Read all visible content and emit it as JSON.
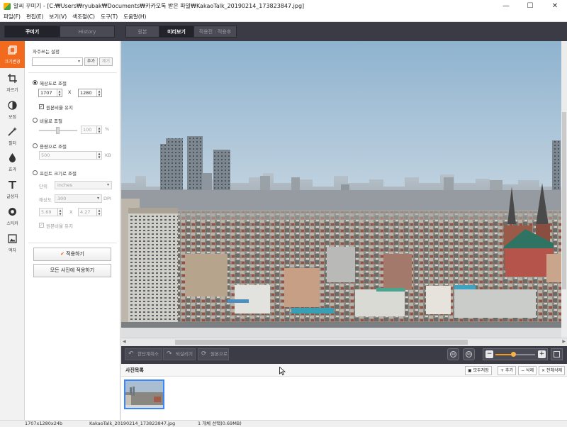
{
  "window": {
    "title": "알씨 꾸미기 - [C:₩Users₩ryubak₩Documents₩카카오톡 받은 파일₩KakaoTalk_20190214_173823847.jpg]",
    "minimize": "—",
    "maximize": "☐",
    "close": "✕"
  },
  "menu": [
    "파일(F)",
    "편집(E)",
    "보기(V)",
    "색조절(C)",
    "도구(T)",
    "도움말(H)"
  ],
  "top_tabs": {
    "left": [
      {
        "label": "꾸미기",
        "active": true
      },
      {
        "label": "History",
        "active": false
      }
    ],
    "right": [
      {
        "label": "원본",
        "active": false
      },
      {
        "label": "미리보기",
        "active": true
      },
      {
        "label": "적용전 : 적용후",
        "active": false
      }
    ]
  },
  "tools": [
    {
      "label": "크기변경",
      "icon": "resize-icon",
      "active": true
    },
    {
      "label": "자르기",
      "icon": "crop-icon",
      "active": false
    },
    {
      "label": "보정",
      "icon": "contrast-icon",
      "active": false
    },
    {
      "label": "필터",
      "icon": "magic-wand-icon",
      "active": false
    },
    {
      "label": "효과",
      "icon": "drop-icon",
      "active": false
    },
    {
      "label": "글상자",
      "icon": "text-icon",
      "active": false
    },
    {
      "label": "스티커",
      "icon": "sticker-icon",
      "active": false
    },
    {
      "label": "액자",
      "icon": "frame-icon",
      "active": false
    }
  ],
  "panel": {
    "preset_label": "자주쓰는 설정",
    "preset_value": "",
    "add_label": "추가",
    "delete_label": "제거",
    "pixel": {
      "label": "해상도로 조절",
      "width": "1707",
      "height": "1280",
      "x": "X",
      "keep_ratio": "원본비율 유지"
    },
    "ratio": {
      "label": "비율로 조절",
      "value": "100",
      "unit": "%",
      "level": 100
    },
    "filesize": {
      "label": "용량으로 조절",
      "value": "500",
      "unit": "KB"
    },
    "print": {
      "label": "프린트 크기로 조절",
      "unit_label": "단위",
      "unit_value": "inches",
      "dpi_label": "해상도",
      "dpi_value": "300",
      "dpi_unit": "DPI",
      "width": "5.69",
      "height": "4.27",
      "x": "X",
      "keep_ratio": "원본비율 유지"
    },
    "apply_label": "적용하기",
    "apply_all_label": "모든 사진에 적용하기"
  },
  "bottom": {
    "undo_label": "한단계취소",
    "redo_label": "되살리기",
    "revert_label": "원본으로",
    "rot_left": "90",
    "rot_right": "90",
    "zoom_minus": "−",
    "zoom_plus": "+",
    "zoom_level": 0.45
  },
  "photo_list": {
    "title": "사진목록",
    "save_all": "모두저장",
    "add": "+ 추가",
    "delete": "− 삭제",
    "delete_all": "× 전체삭제"
  },
  "status": {
    "dimensions": "1707x1280x24b",
    "filename": "KakaoTalk_20190214_173823847.jpg",
    "selection": "1 개체 선택(0.69MB)"
  },
  "colors": {
    "accent": "#f26a1d",
    "dark": "#3b3b45",
    "selection": "#3a86ff"
  }
}
